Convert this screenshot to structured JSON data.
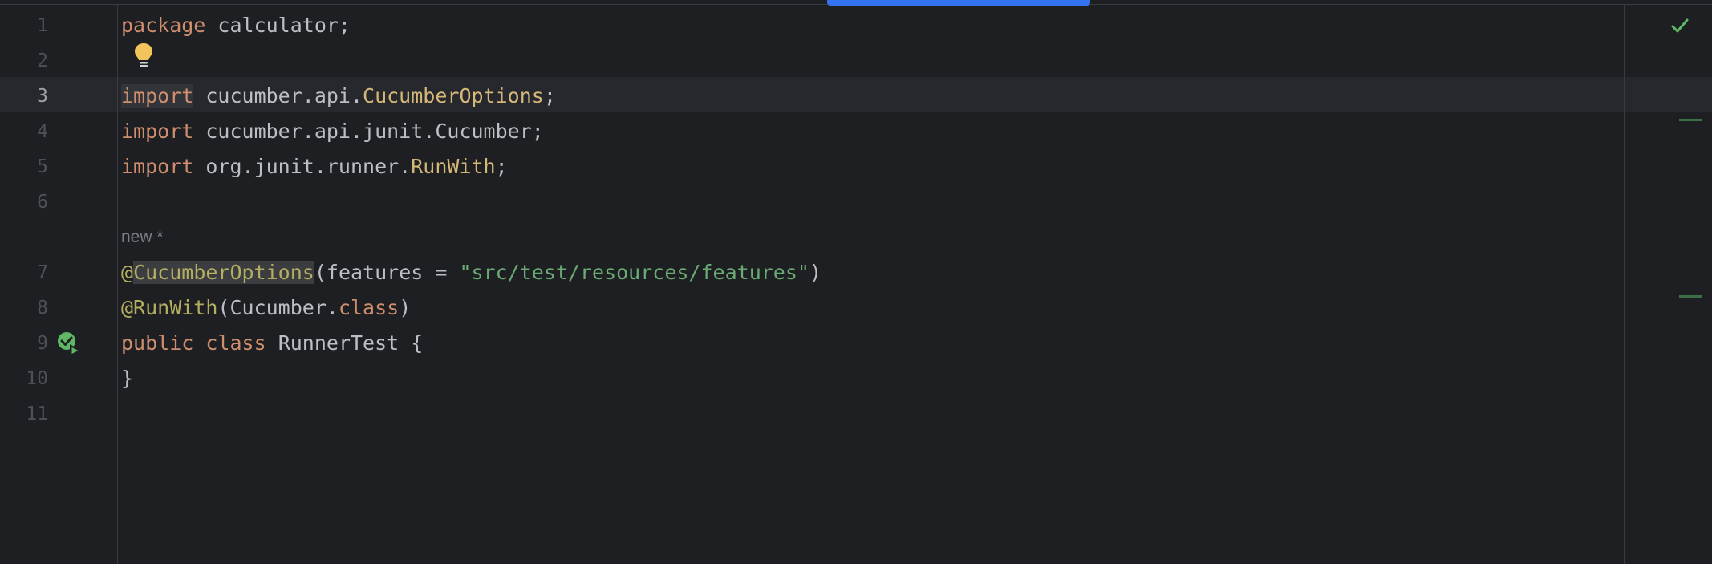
{
  "editor": {
    "inlay_hint": "new *",
    "lines": [
      {
        "num": "1",
        "active": false,
        "tokens": [
          {
            "t": "package",
            "c": "kw"
          },
          {
            "t": " calculator;",
            "c": ""
          }
        ]
      },
      {
        "num": "2",
        "active": false,
        "tokens": []
      },
      {
        "num": "3",
        "active": true,
        "tokens": [
          {
            "t": "import",
            "c": "kw hl-import"
          },
          {
            "t": " cucumber.api.",
            "c": ""
          },
          {
            "t": "CucumberOptions",
            "c": "cls"
          },
          {
            "t": ";",
            "c": ""
          }
        ]
      },
      {
        "num": "4",
        "active": false,
        "tokens": [
          {
            "t": "import",
            "c": "kw"
          },
          {
            "t": " cucumber.api.junit.Cucumber;",
            "c": ""
          }
        ]
      },
      {
        "num": "5",
        "active": false,
        "tokens": [
          {
            "t": "import",
            "c": "kw"
          },
          {
            "t": " org.junit.runner.",
            "c": ""
          },
          {
            "t": "RunWith",
            "c": "cls"
          },
          {
            "t": ";",
            "c": ""
          }
        ]
      },
      {
        "num": "6",
        "active": false,
        "tokens": []
      },
      {
        "num": "7",
        "active": false,
        "tokens": [
          {
            "t": "@",
            "c": "ann"
          },
          {
            "t": "CucumberOptions",
            "c": "ann hl-ann"
          },
          {
            "t": "(features = ",
            "c": ""
          },
          {
            "t": "\"src/test/resources/features\"",
            "c": "str"
          },
          {
            "t": ")",
            "c": ""
          }
        ]
      },
      {
        "num": "8",
        "active": false,
        "tokens": [
          {
            "t": "@RunWith",
            "c": "ann"
          },
          {
            "t": "(Cucumber.",
            "c": ""
          },
          {
            "t": "class",
            "c": "kw"
          },
          {
            "t": ")",
            "c": ""
          }
        ]
      },
      {
        "num": "9",
        "active": false,
        "tokens": [
          {
            "t": "public",
            "c": "kw"
          },
          {
            "t": " ",
            "c": ""
          },
          {
            "t": "class",
            "c": "kw"
          },
          {
            "t": " RunnerTest {",
            "c": ""
          }
        ]
      },
      {
        "num": "10",
        "active": false,
        "tokens": [
          {
            "t": "}",
            "c": ""
          }
        ]
      },
      {
        "num": "11",
        "active": false,
        "tokens": []
      }
    ]
  },
  "icons": {
    "bulb": "lightbulb-icon",
    "run": "run-test-icon",
    "status": "checkmark-icon"
  },
  "colors": {
    "background": "#1e1f22",
    "keyword": "#cf8e6d",
    "class_ref": "#d5b778",
    "annotation": "#b3ae60",
    "string": "#6aab73",
    "accent": "#3574f0"
  }
}
